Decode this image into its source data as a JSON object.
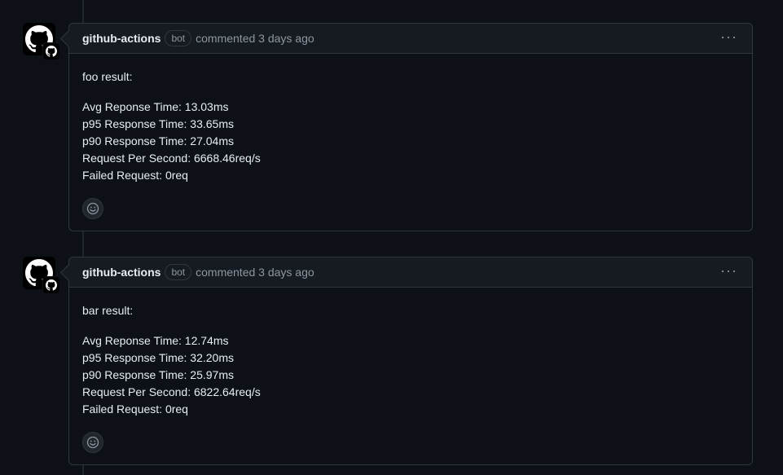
{
  "comments": [
    {
      "author": "github-actions",
      "badge": "bot",
      "commented": "commented",
      "time": "3 days ago",
      "more": "···",
      "body_title": "foo result:",
      "metrics": [
        "Avg Reponse Time: 13.03ms",
        "p95 Response Time: 33.65ms",
        "p90 Response Time: 27.04ms",
        "Request Per Second: 6668.46req/s",
        "Failed Request: 0req"
      ]
    },
    {
      "author": "github-actions",
      "badge": "bot",
      "commented": "commented",
      "time": "3 days ago",
      "more": "···",
      "body_title": "bar result:",
      "metrics": [
        "Avg Reponse Time: 12.74ms",
        "p95 Response Time: 32.20ms",
        "p90 Response Time: 25.97ms",
        "Request Per Second: 6822.64req/s",
        "Failed Request: 0req"
      ]
    }
  ],
  "icons": {
    "avatar": "github-mark-icon",
    "badge": "github-mark-icon",
    "reaction": "smiley-icon",
    "more": "kebab-horizontal-icon"
  },
  "colors": {
    "background": "#0d1117",
    "header": "#161b22",
    "border": "#30363d",
    "muted": "#8d96a0",
    "text": "#e6edf3"
  }
}
